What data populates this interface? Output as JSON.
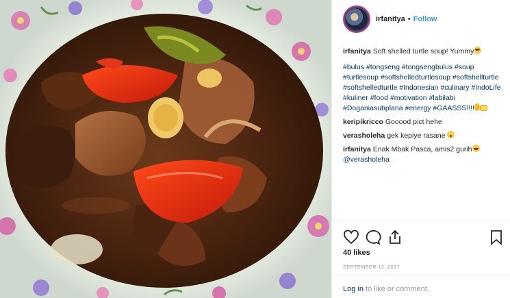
{
  "post": {
    "username": "irfanitya",
    "separator": "•",
    "follow_label": "Follow"
  },
  "caption": {
    "username": "irfanitya",
    "text": "Soft shelled turtle soup! Yummy",
    "hashtags": "#bulus #tongseng #tongsengbulus #soup #turtlesoup #softshelledturtlesoup #softshellturtle #softshelledturtle #Indonesian #culinary #IndoLife #kuliner #food #motivation #labilabi #Doganiasubplana #energy #GAASSS!!!!"
  },
  "comments": [
    {
      "username": "keripikricco",
      "text": "Gooood pict hehe"
    },
    {
      "username": "verasholeha",
      "text": "gek kepiye rasane"
    },
    {
      "username": "irfanitya",
      "text": "Enak Mbak Pasca, amis2 gurih",
      "mention": "@verasholeha"
    }
  ],
  "icons": {
    "like": "heart-icon",
    "comment": "comment-icon",
    "share": "share-icon",
    "save": "bookmark-icon"
  },
  "likes": "40 likes",
  "date": "SEPTEMBER 12, 2017",
  "footer": {
    "login": "Log in",
    "rest": "to like or comment."
  },
  "colors": {
    "link": "#3897f0",
    "hashtag": "#003569",
    "muted": "#999999"
  }
}
